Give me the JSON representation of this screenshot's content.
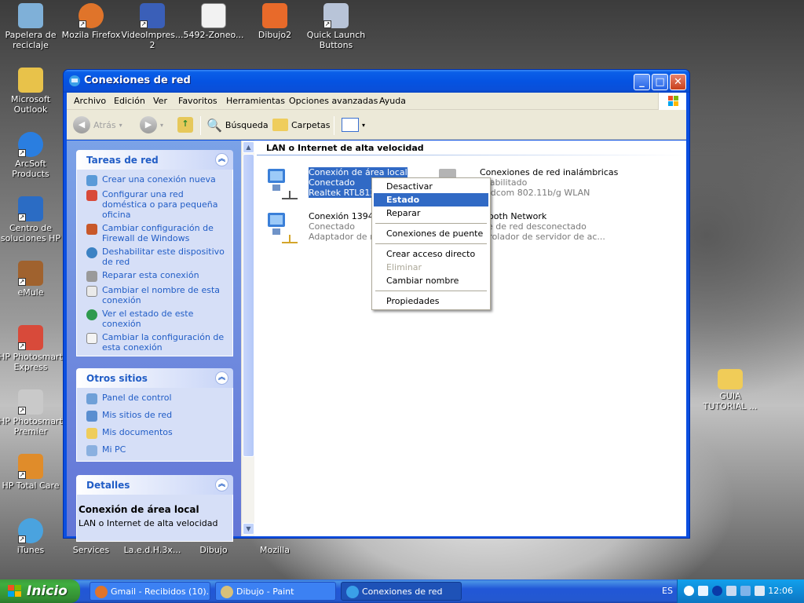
{
  "desktop": {
    "icons_left": [
      {
        "label": "Papelera de reciclaje",
        "icon": "recycle-bin-icon",
        "color": "#7fb0d8"
      },
      {
        "label": "Microsoft Outlook",
        "icon": "outlook-icon",
        "color": "#e8c24a"
      },
      {
        "label": "ArcSoft Products",
        "icon": "ie-globe-icon",
        "color": "#2a7ee0"
      },
      {
        "label": "Centro de soluciones HP",
        "icon": "hp-icon",
        "color": "#2b6cc4"
      },
      {
        "label": "eMule",
        "icon": "emule-mule-icon",
        "color": "#a0622e"
      },
      {
        "label": "HP Photosmart Express",
        "icon": "hp-photosmart-icon",
        "color": "#d84a3a"
      },
      {
        "label": "HP Photosmart Premier",
        "icon": "hp-camera-icon",
        "color": "#c9c9c9"
      },
      {
        "label": "HP Total Care",
        "icon": "hp-totalcare-icon",
        "color": "#e08c2a"
      },
      {
        "label": "iTunes",
        "icon": "itunes-icon",
        "color": "#4aa3df"
      }
    ],
    "icons_top": [
      {
        "label": "Mozila Firefox",
        "icon": "firefox-icon",
        "color": "#e0742a"
      },
      {
        "label": "VideoImpres... 2",
        "icon": "video-icon",
        "color": "#3a5fb8"
      },
      {
        "label": "5492-Zoneo...",
        "icon": "document-icon",
        "color": "#f2f2f2"
      },
      {
        "label": "Dibujo2",
        "icon": "image-file-icon",
        "color": "#e86a2a"
      },
      {
        "label": "Quick Launch Buttons",
        "icon": "rocket-icon",
        "color": "#b8c4d8"
      }
    ],
    "icons_bottom": [
      {
        "label": "Services"
      },
      {
        "label": "La.e.d.H.3x..."
      },
      {
        "label": "Dibujo"
      },
      {
        "label": "Mozilla"
      }
    ],
    "right_folder": {
      "label": "GUIA TUTORIAL ...",
      "icon": "folder-icon",
      "color": "#f0cc58"
    }
  },
  "window": {
    "title": "Conexiones de red",
    "menu": [
      "Archivo",
      "Edición",
      "Ver",
      "Favoritos",
      "Herramientas",
      "Opciones avanzadas",
      "Ayuda"
    ],
    "toolbar": {
      "back": "Atrás",
      "search": "Búsqueda",
      "folders": "Carpetas"
    },
    "tasks_panel": {
      "title": "Tareas de red",
      "items": [
        "Crear una conexión nueva",
        "Configurar una red doméstica o para pequeña oficina",
        "Cambiar configuración de Firewall de Windows",
        "Deshabilitar este dispositivo de red",
        "Reparar esta conexión",
        "Cambiar el nombre de esta conexión",
        "Ver el estado de este conexión",
        "Cambiar la configuración de esta conexión"
      ]
    },
    "other_panel": {
      "title": "Otros sitios",
      "items": [
        "Panel de control",
        "Mis sitios de red",
        "Mis documentos",
        "Mi PC"
      ]
    },
    "details_panel": {
      "title": "Detalles",
      "name": "Conexión de área local",
      "type": "LAN o Internet de alta velocidad"
    },
    "group_header": "LAN o Internet de alta velocidad",
    "connections": [
      {
        "name": "Conexión de área local",
        "status": "Conectado",
        "device": "Realtek RTL8139",
        "selected": true
      },
      {
        "name": "Conexiones de red inalámbricas",
        "status": "shabilitado",
        "device": "padcom 802.11b/g WLAN",
        "selected": false
      },
      {
        "name": "Conexión 1394",
        "status": "Conectado",
        "device": "Adaptador de re",
        "selected": false
      },
      {
        "name": "etooth Network",
        "status": "ble de red desconectado",
        "device": "ntrolador de servidor de ac...",
        "selected": false
      }
    ]
  },
  "context_menu": {
    "items": [
      {
        "label": "Desactivar",
        "state": "normal"
      },
      {
        "label": "Estado",
        "state": "highlighted"
      },
      {
        "label": "Reparar",
        "state": "normal"
      },
      {
        "sep": true
      },
      {
        "label": "Conexiones de puente",
        "state": "normal"
      },
      {
        "sep": true
      },
      {
        "label": "Crear acceso directo",
        "state": "normal"
      },
      {
        "label": "Eliminar",
        "state": "disabled"
      },
      {
        "label": "Cambiar nombre",
        "state": "normal"
      },
      {
        "sep": true
      },
      {
        "label": "Propiedades",
        "state": "normal"
      }
    ]
  },
  "taskbar": {
    "start": "Inicio",
    "tasks": [
      {
        "label": "Gmail - Recibidos (10)...",
        "icon": "firefox-icon",
        "active": false
      },
      {
        "label": "Dibujo - Paint",
        "icon": "paint-icon",
        "active": false
      },
      {
        "label": "Conexiones de red",
        "icon": "network-icon",
        "active": true
      }
    ],
    "lang": "ES",
    "clock": "12:06"
  }
}
